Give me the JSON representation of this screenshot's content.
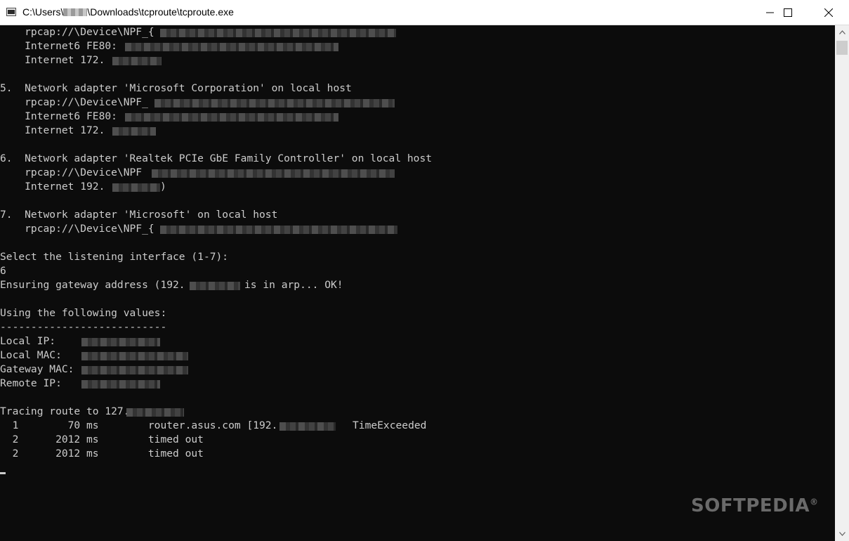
{
  "window": {
    "title_prefix": "C:\\Users\\",
    "title_suffix": "\\Downloads\\tcproute\\tcproute.exe",
    "minimize_icon": "minimize-icon",
    "maximize_icon": "maximize-icon",
    "close_icon": "close-icon"
  },
  "console": {
    "lines": [
      "    rpcap://\\Device\\NPF_{",
      "    Internet6 FE80:",
      "    Internet 172.",
      "",
      "5.  Network adapter 'Microsoft Corporation' on local host",
      "    rpcap://\\Device\\NPF_",
      "    Internet6 FE80:",
      "    Internet 172.",
      "",
      "6.  Network adapter 'Realtek PCIe GbE Family Controller' on local host",
      "    rpcap://\\Device\\NPF",
      "    Internet 192.",
      "",
      "7.  Network adapter 'Microsoft' on local host",
      "    rpcap://\\Device\\NPF_{",
      "",
      "Select the listening interface (1-7):",
      "6",
      "Ensuring gateway address (192.",
      "",
      "Using the following values:",
      "---------------------------",
      "Local IP:",
      "Local MAC:",
      "Gateway MAC:",
      "Remote IP:",
      "",
      "Tracing route to 127.",
      "  1        70 ms        router.asus.com [192.",
      "  2      2012 ms        timed out",
      "  2      2012 ms        timed out"
    ],
    "arp_suffix": "is in arp... OK!",
    "paren_close": ")",
    "gateway_prefix": "(",
    "trace_status": "TimeExceeded"
  },
  "watermark": "SOFTPEDIA",
  "watermark_mark": "®",
  "scrollbar": {
    "up_icon": "scroll-up-arrow-icon",
    "down_icon": "scroll-down-arrow-icon"
  }
}
